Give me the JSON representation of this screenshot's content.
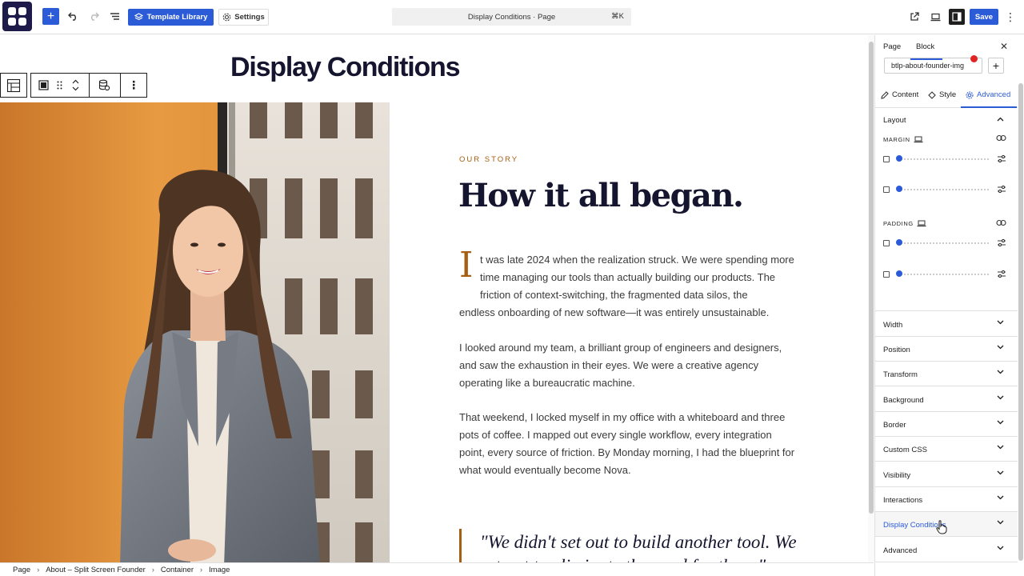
{
  "topbar": {
    "template_library_label": "Template Library",
    "settings_label": "Settings",
    "command_label": "Display Conditions · Page",
    "command_shortcut": "⌘K",
    "save_label": "Save"
  },
  "canvas": {
    "page_title": "Display Conditions",
    "story_label": "OUR STORY",
    "story_heading": "How it all began.",
    "dropcap": "I",
    "paragraph1_start": "t was late 2024 when the realization struck. We were spending more time managing our tools than actually building our products. The friction of context-switching, the fragmented data silos, the",
    "paragraph1_end": "endless onboarding of new software—it was entirely unsustainable.",
    "paragraph2": "I looked around my team, a brilliant group of engineers and designers, and saw the exhaustion in their eyes. We were a creative agency operating like a bureaucratic machine.",
    "paragraph3": "That weekend, I locked myself in my office with a whiteboard and three pots of coffee. I mapped out every single workflow, every integration point, every source of friction. By Monday morning, I had the blueprint for what would eventually become Nova.",
    "quote": "\"We didn't set out to build another tool. We set out to eliminate the need for them.\""
  },
  "breadcrumb": [
    "Page",
    "About – Split Screen Founder",
    "Container",
    "Image"
  ],
  "sidebar": {
    "tabs": [
      "Page",
      "Block"
    ],
    "block_name": "btlp-about-founder-img",
    "subtabs": [
      "Content",
      "Style",
      "Advanced"
    ],
    "layout_title": "Layout",
    "margin_label": "MARGIN",
    "padding_label": "PADDING",
    "sections": [
      "Width",
      "Position",
      "Transform",
      "Background",
      "Border",
      "Custom CSS",
      "Visibility",
      "Interactions",
      "Display Conditions",
      "Advanced"
    ],
    "active_section": "Display Conditions"
  },
  "colors": {
    "accent": "#2c5bd8",
    "brand_dark": "#1e1b4b",
    "story_accent": "#a65e12",
    "heading": "#15152f",
    "badge_red": "#e02424"
  }
}
